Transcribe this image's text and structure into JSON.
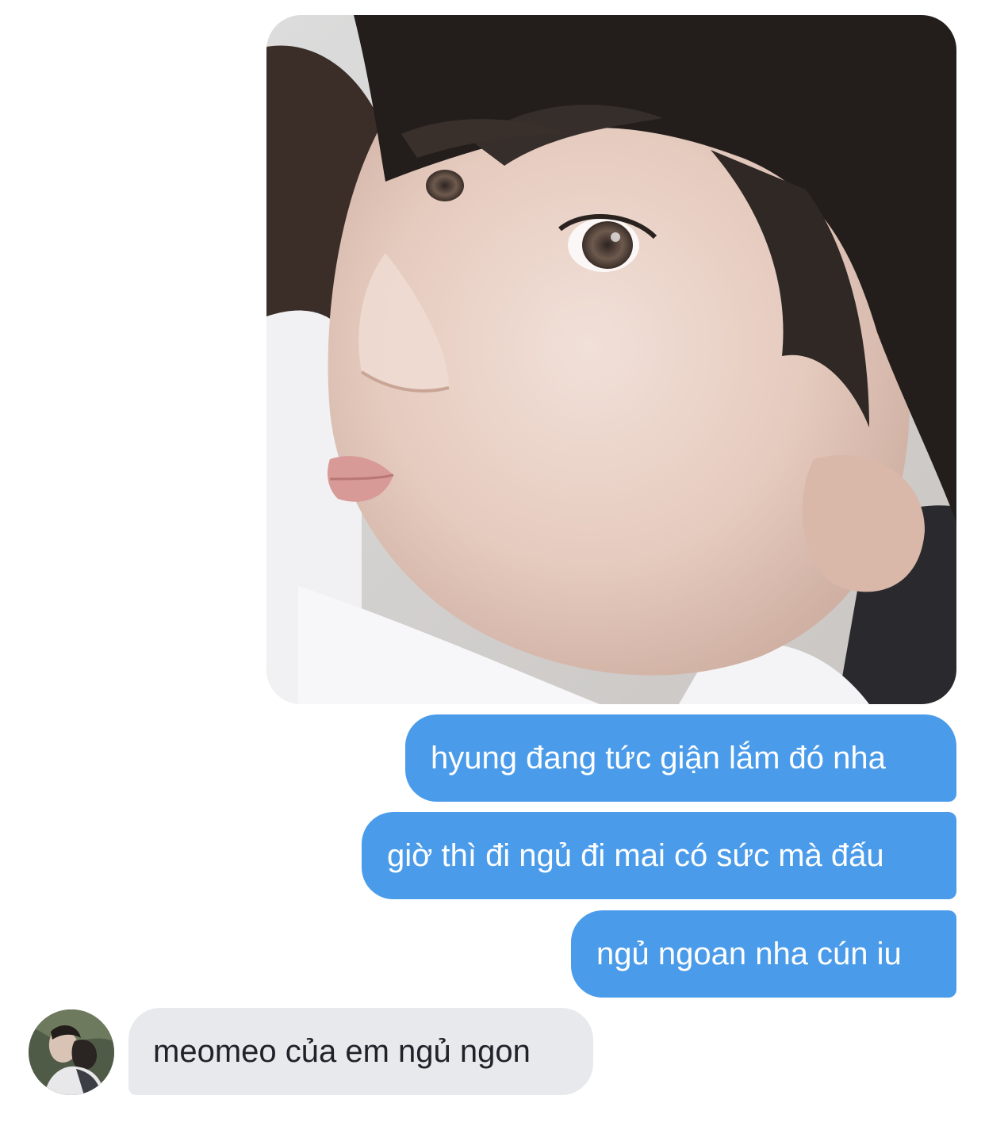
{
  "thread": {
    "photo_message": {
      "kind": "image",
      "alt_subject": "close-up selfie photo"
    },
    "messages": [
      {
        "direction": "outgoing",
        "text": "hyung đang tức giận lắm đó nha"
      },
      {
        "direction": "outgoing",
        "text": "giờ thì đi ngủ đi mai có sức mà đấu"
      },
      {
        "direction": "outgoing",
        "text": "ngủ ngoan nha cún iu"
      },
      {
        "direction": "incoming",
        "text": "meomeo của em ngủ ngon"
      }
    ]
  },
  "colors": {
    "outgoing_bubble": "#4a9be9",
    "incoming_bubble": "#e7e9ed",
    "outgoing_text": "#ffffff",
    "incoming_text": "#1f2329",
    "background": "#ffffff"
  },
  "icons": {
    "avatar": "contact-avatar"
  }
}
